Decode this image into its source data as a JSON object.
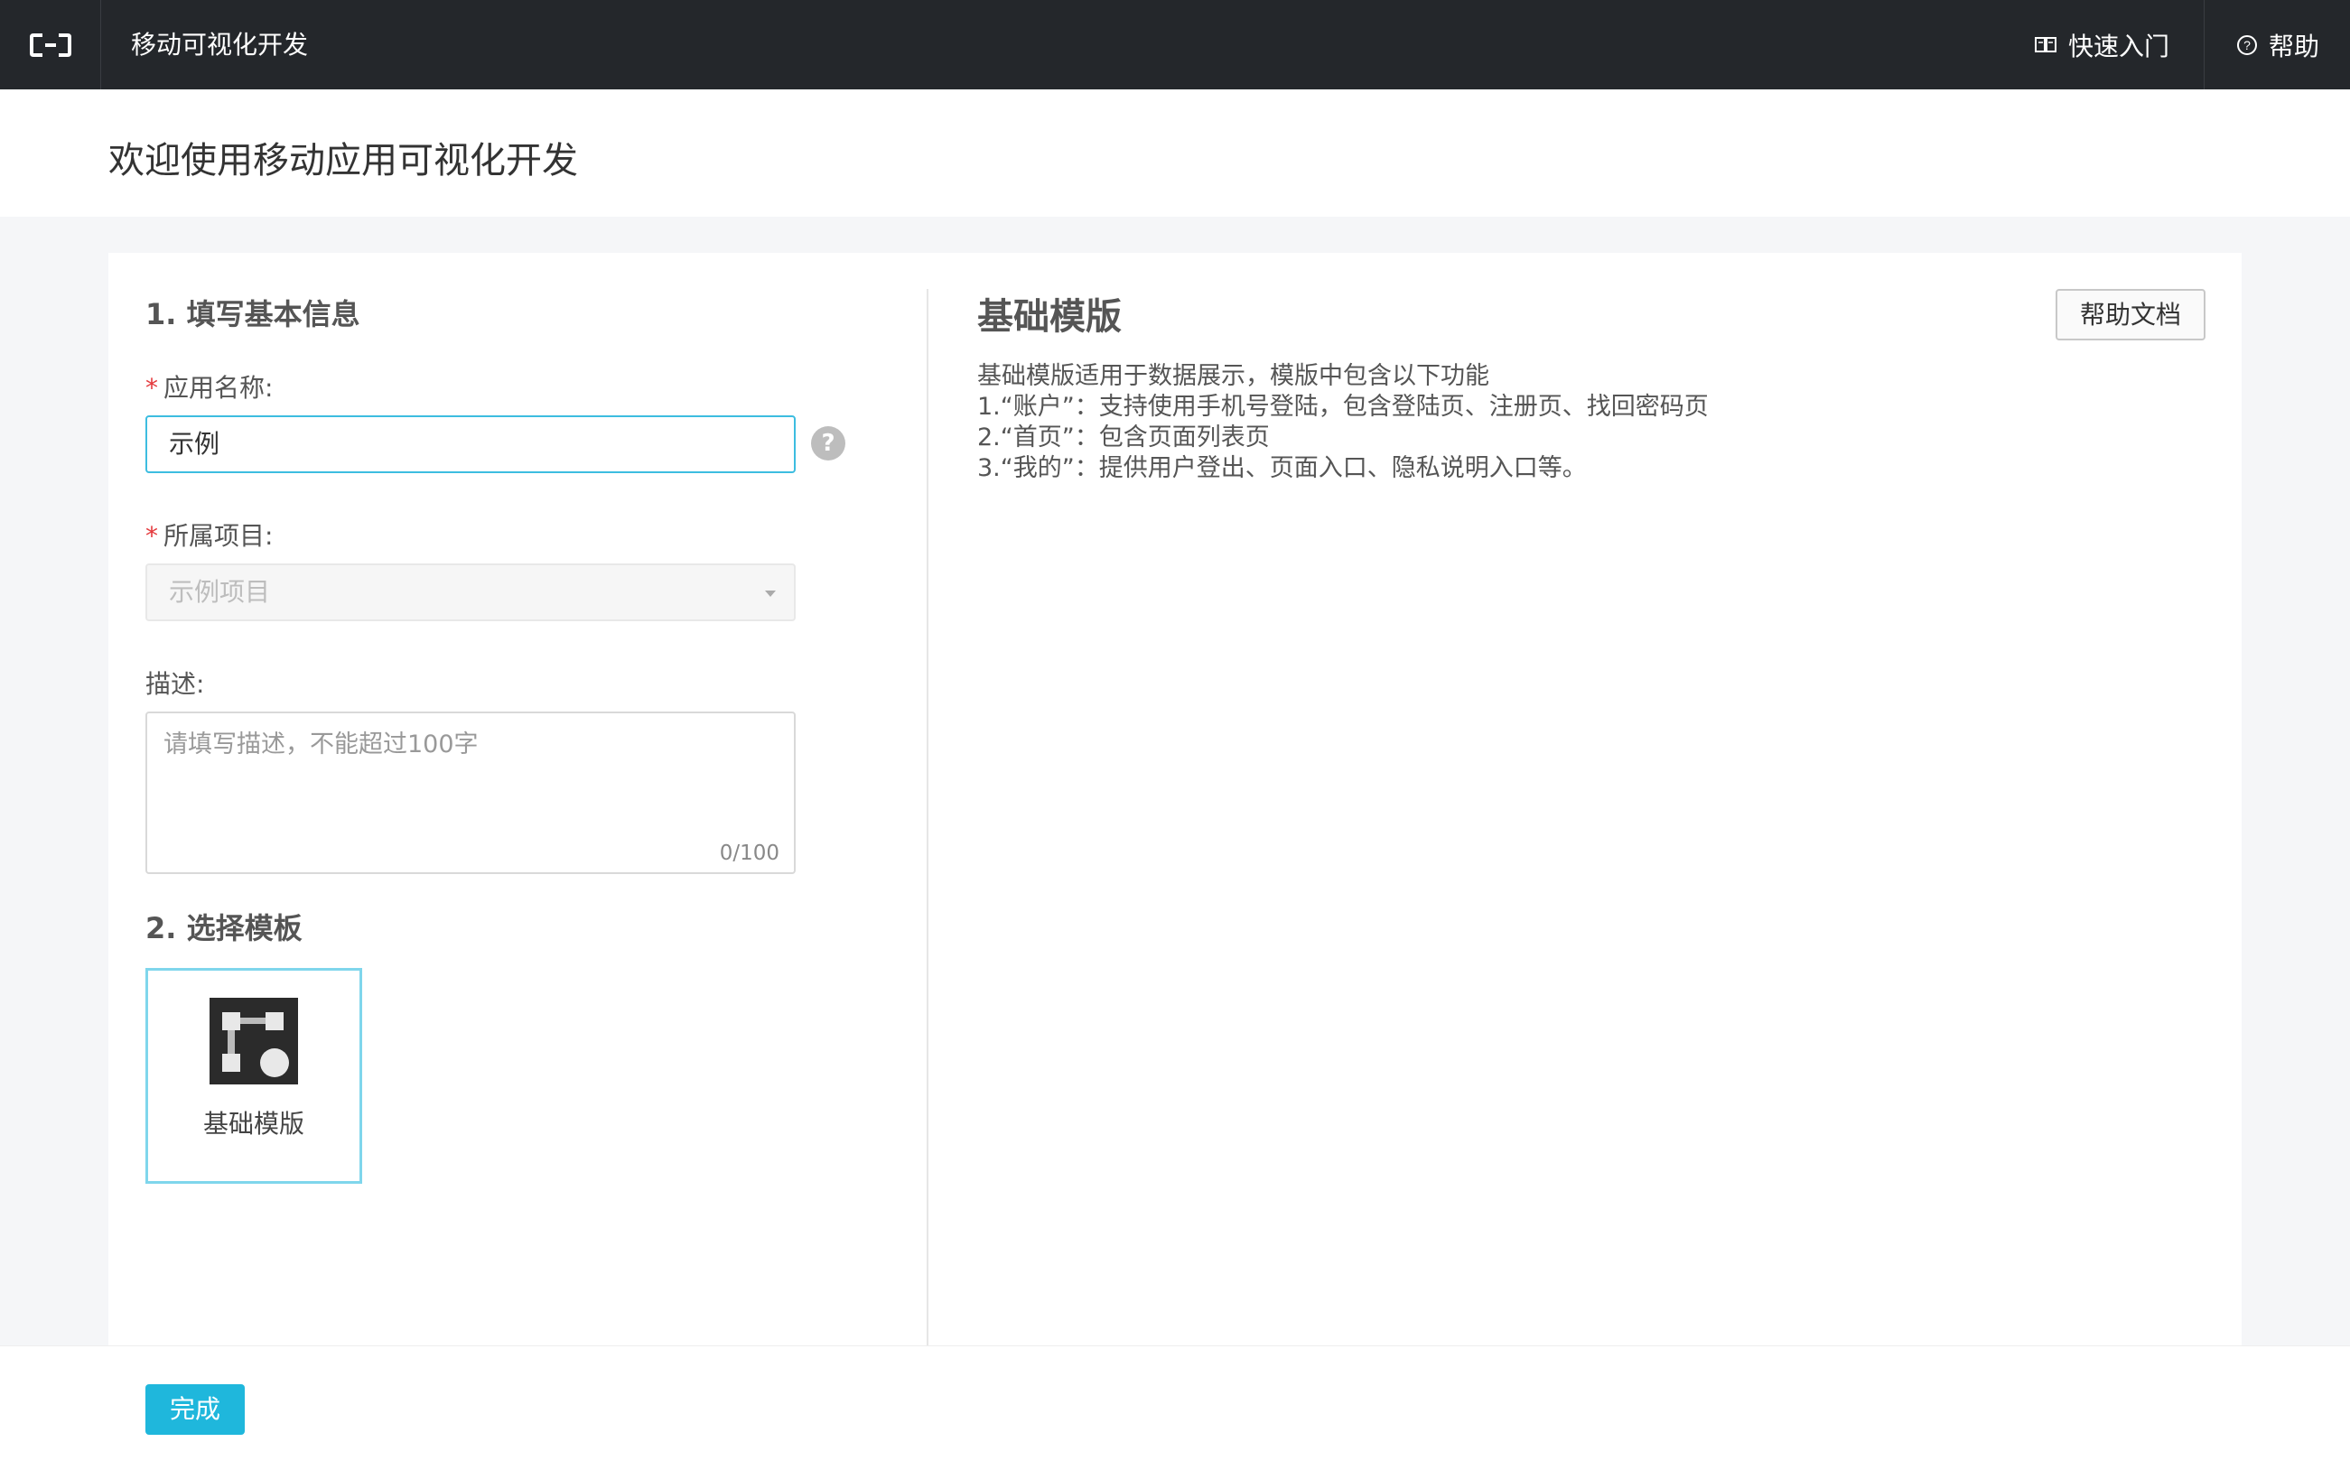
{
  "topbar": {
    "app_title": "移动可视化开发",
    "quick_start": "快速入门",
    "help": "帮助",
    "bg_color": "#24272b"
  },
  "page": {
    "title": "欢迎使用移动应用可视化开发"
  },
  "form": {
    "section1_title": "1. 填写基本信息",
    "required_mark": "*",
    "app_name_label": "应用名称:",
    "app_name_value": "示例",
    "help_tooltip_icon": "?",
    "project_label": "所属项目:",
    "project_value": "示例项目",
    "desc_label": "描述:",
    "desc_placeholder": "请填写描述，不能超过100字",
    "desc_counter": "0/100",
    "section2_title": "2. 选择模板",
    "template_name": "基础模版",
    "accent_color": "#3dbde0"
  },
  "template_detail": {
    "title": "基础模版",
    "doc_button": "帮助文档",
    "lines": [
      "基础模版适用于数据展示，模版中包含以下功能",
      "1.“账户”：支持使用手机号登陆，包含登陆页、注册页、找回密码页",
      "2.“首页”：包含页面列表页",
      "3.“我的”：提供用户登出、页面入口、隐私说明入口等。"
    ]
  },
  "footer": {
    "done_button": "完成",
    "button_color": "#1fb7dc"
  }
}
